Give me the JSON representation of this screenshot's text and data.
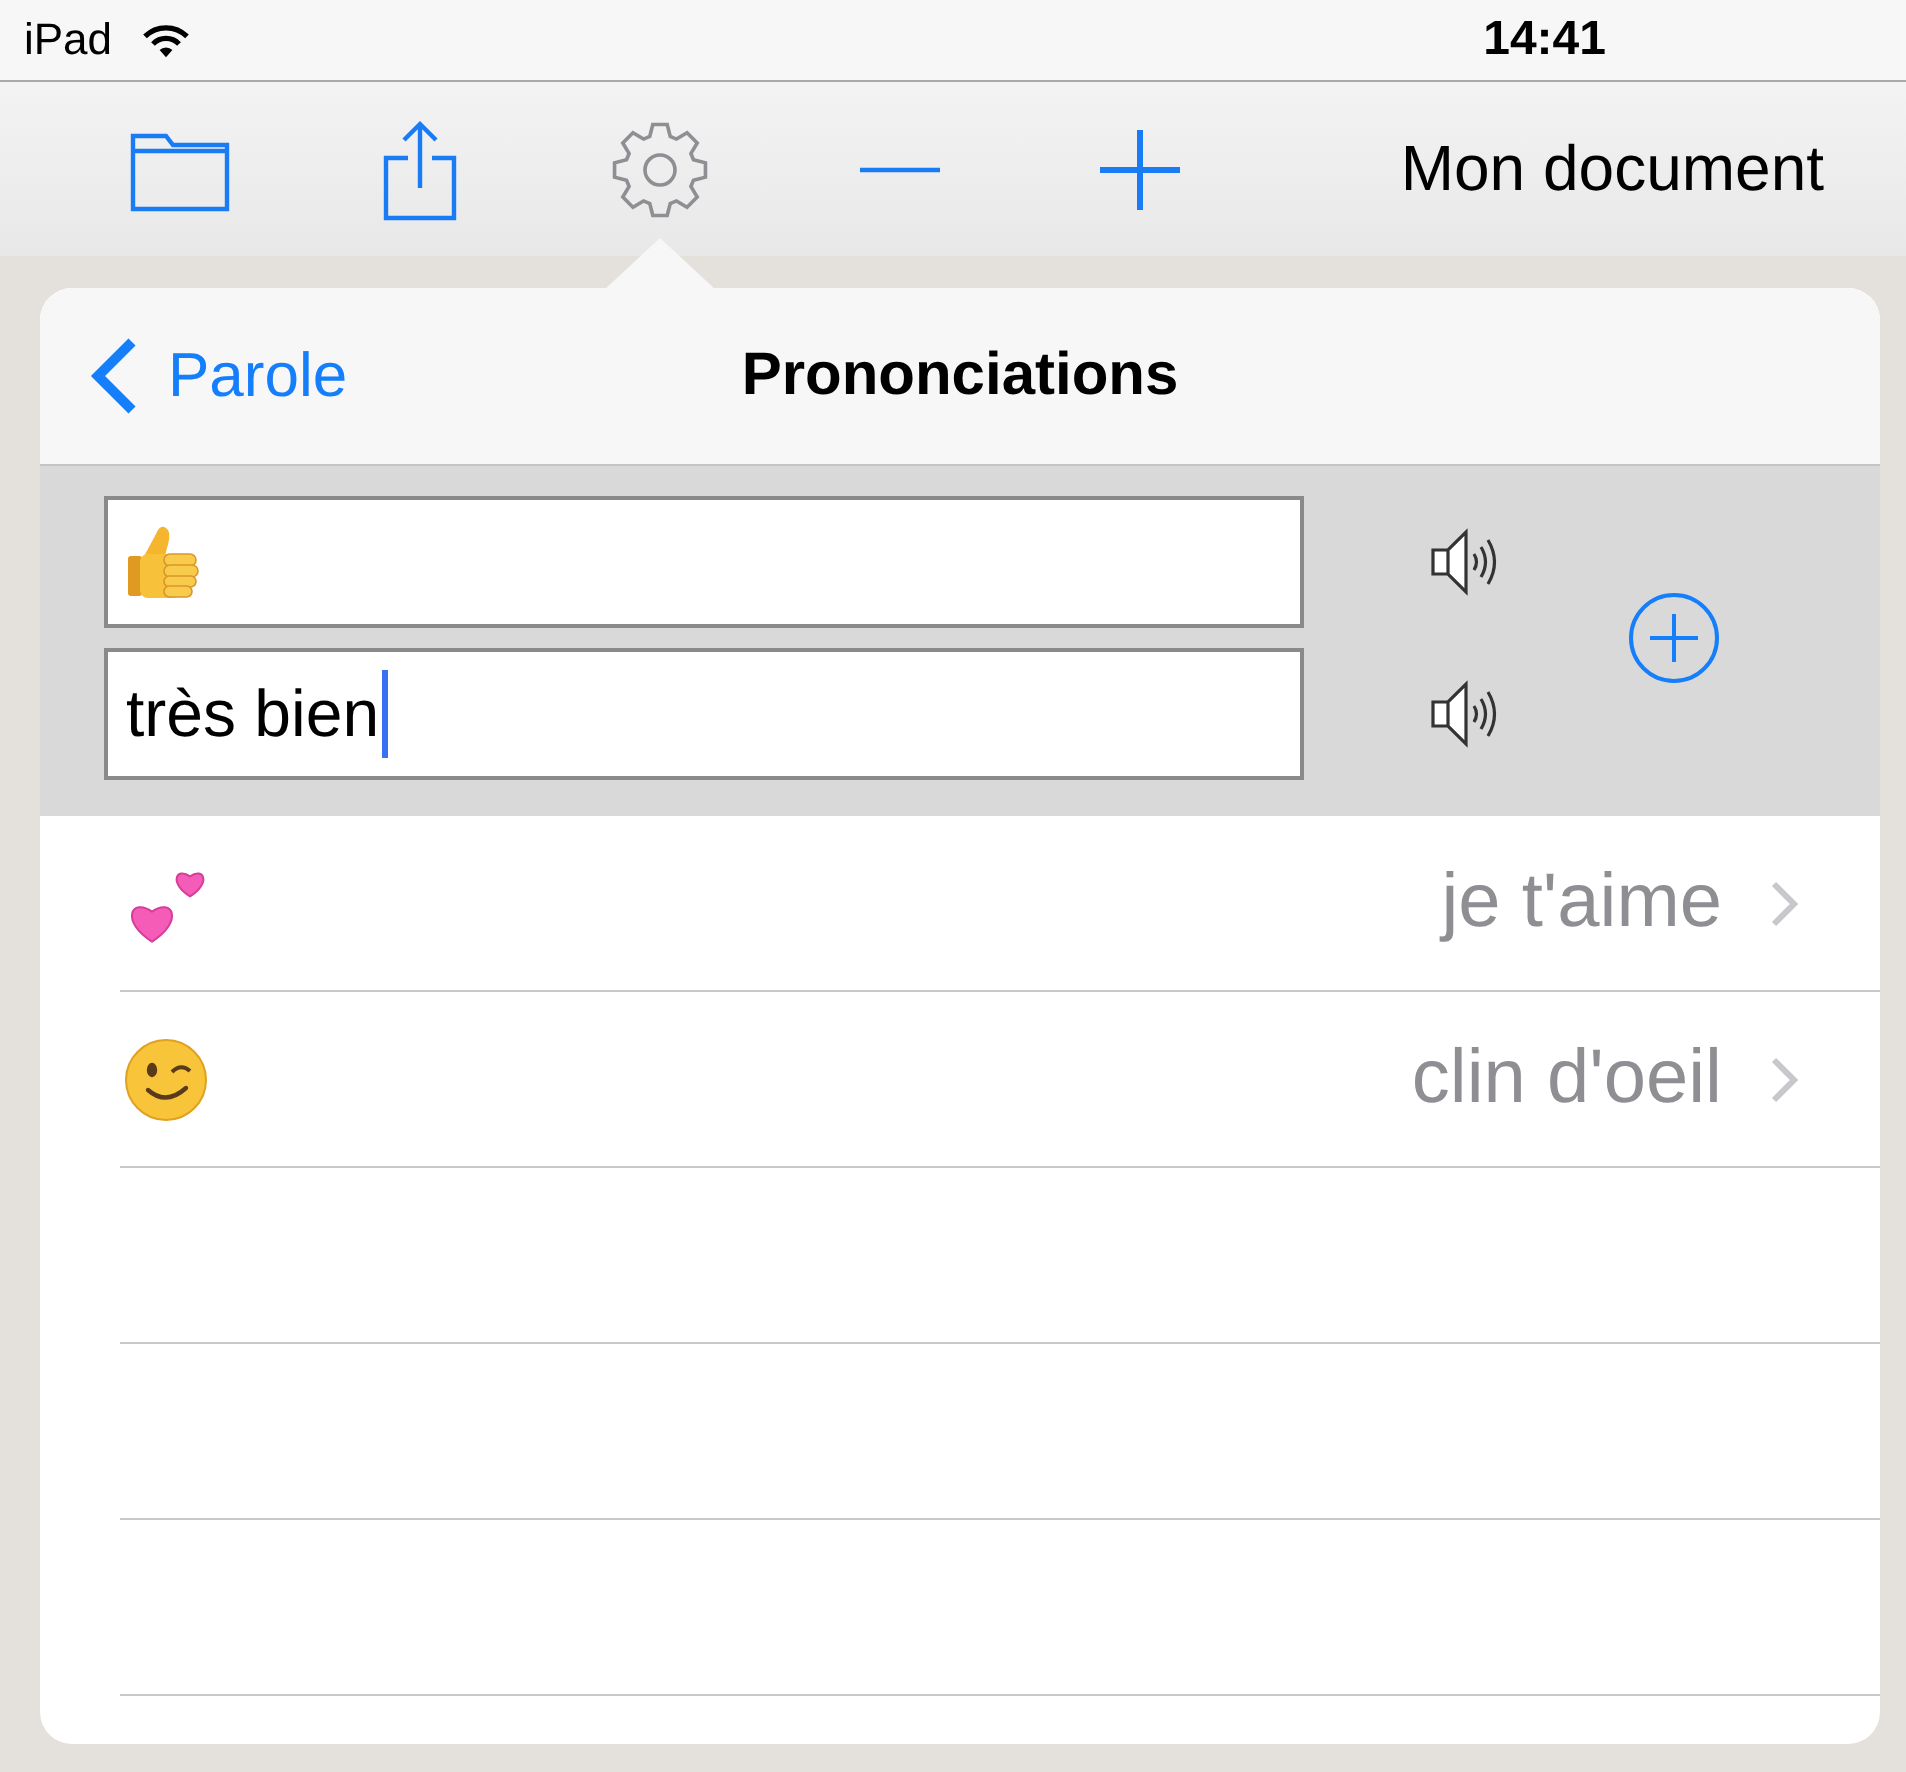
{
  "status_bar": {
    "device": "iPad",
    "time": "14:41"
  },
  "toolbar": {
    "buttons": [
      {
        "kind": "folder",
        "selected": false
      },
      {
        "kind": "share",
        "selected": false
      },
      {
        "kind": "settings",
        "selected": true
      },
      {
        "kind": "minus",
        "selected": false
      },
      {
        "kind": "plus",
        "selected": false
      }
    ],
    "title": "Mon document"
  },
  "popover": {
    "back_label": "Parole",
    "title": "Prononciations",
    "entry": {
      "fields": [
        {
          "kind": "thumbs-up",
          "focused": false
        },
        {
          "kind": "text",
          "value": "très bien",
          "focused": true
        }
      ]
    },
    "rows": [
      {
        "kind": "hearts",
        "label": "je t'aime"
      },
      {
        "kind": "wink",
        "label": "clin d'oeil"
      }
    ]
  }
}
